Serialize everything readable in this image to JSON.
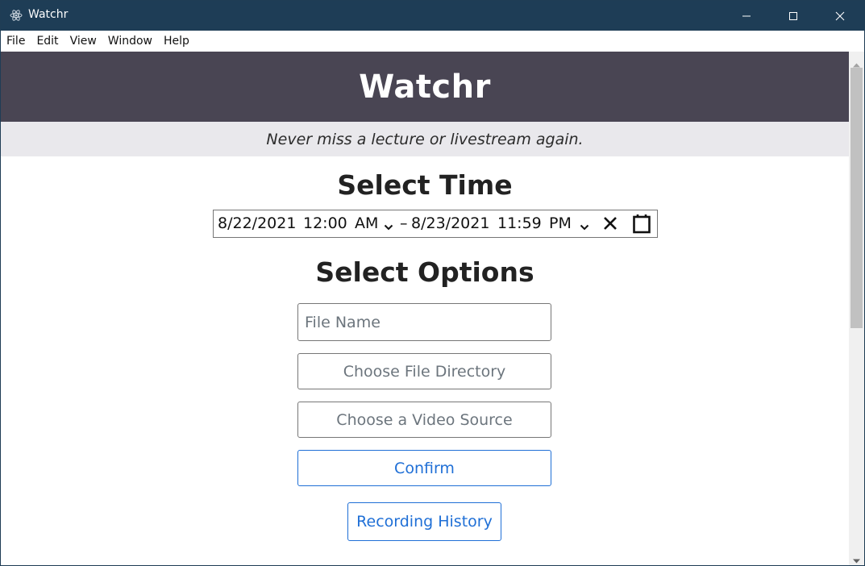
{
  "window": {
    "title": "Watchr",
    "icons": {
      "app": "electron-atom-icon",
      "minimize": "minimize-icon",
      "maximize": "maximize-icon",
      "close": "close-icon"
    }
  },
  "menubar": {
    "items": [
      {
        "label": "File"
      },
      {
        "label": "Edit"
      },
      {
        "label": "View"
      },
      {
        "label": "Window"
      },
      {
        "label": "Help"
      }
    ]
  },
  "header": {
    "title": "Watchr",
    "tagline": "Never miss a lecture or livestream again."
  },
  "time_section": {
    "title": "Select Time",
    "range": {
      "start_date": "8/22/2021",
      "start_time": "12:00",
      "start_ampm": "AM",
      "separator": "–",
      "end_date": "8/23/2021",
      "end_time": "11:59",
      "end_ampm": "PM",
      "clear_icon": "clear-x-icon",
      "calendar_icon": "calendar-icon"
    }
  },
  "options_section": {
    "title": "Select Options",
    "file_name_placeholder": "File Name",
    "choose_directory_label": "Choose File Directory",
    "choose_source_label": "Choose a Video Source",
    "confirm_label": "Confirm",
    "history_label": "Recording History"
  },
  "colors": {
    "titlebar": "#1e3d56",
    "header": "#494553",
    "tagline_bg": "#e9e8ec",
    "primary": "#1f6fd6",
    "secondary": "#6c757d"
  }
}
